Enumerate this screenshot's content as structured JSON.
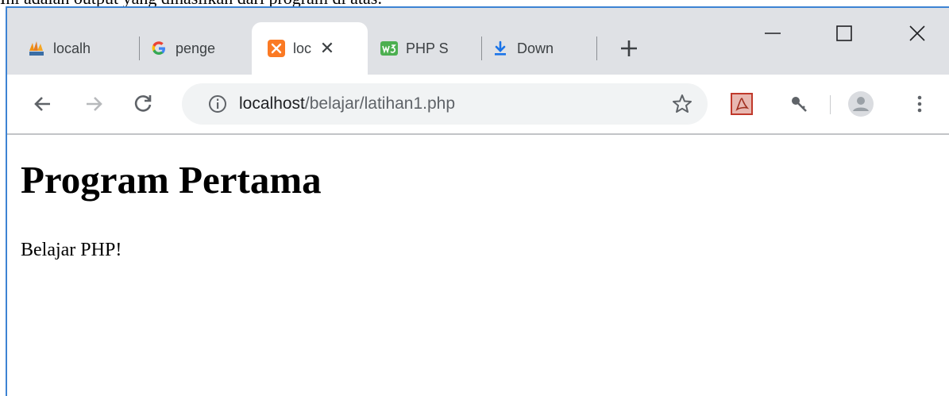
{
  "caption": "Ini adalah output yang dihasilkan dari program di atas:",
  "browser": {
    "tabs": [
      {
        "title": "localh",
        "icon": "phpmyadmin-icon"
      },
      {
        "title": "penge",
        "icon": "google-icon"
      },
      {
        "title": "loc",
        "icon": "xampp-icon",
        "active": true
      },
      {
        "title": "PHP S",
        "icon": "w3schools-icon"
      },
      {
        "title": "Down",
        "icon": "download-icon"
      }
    ],
    "new_tab_label": "+",
    "close_label": "✕",
    "address": {
      "host": "localhost",
      "path": "/belajar/latihan1.php"
    }
  },
  "page": {
    "heading": "Program Pertama",
    "paragraph": "Belajar PHP!"
  },
  "colors": {
    "accent": "#3d83d3",
    "xampp": "#fb7a24",
    "w3schools": "#4caf50",
    "download": "#1a73e8"
  }
}
